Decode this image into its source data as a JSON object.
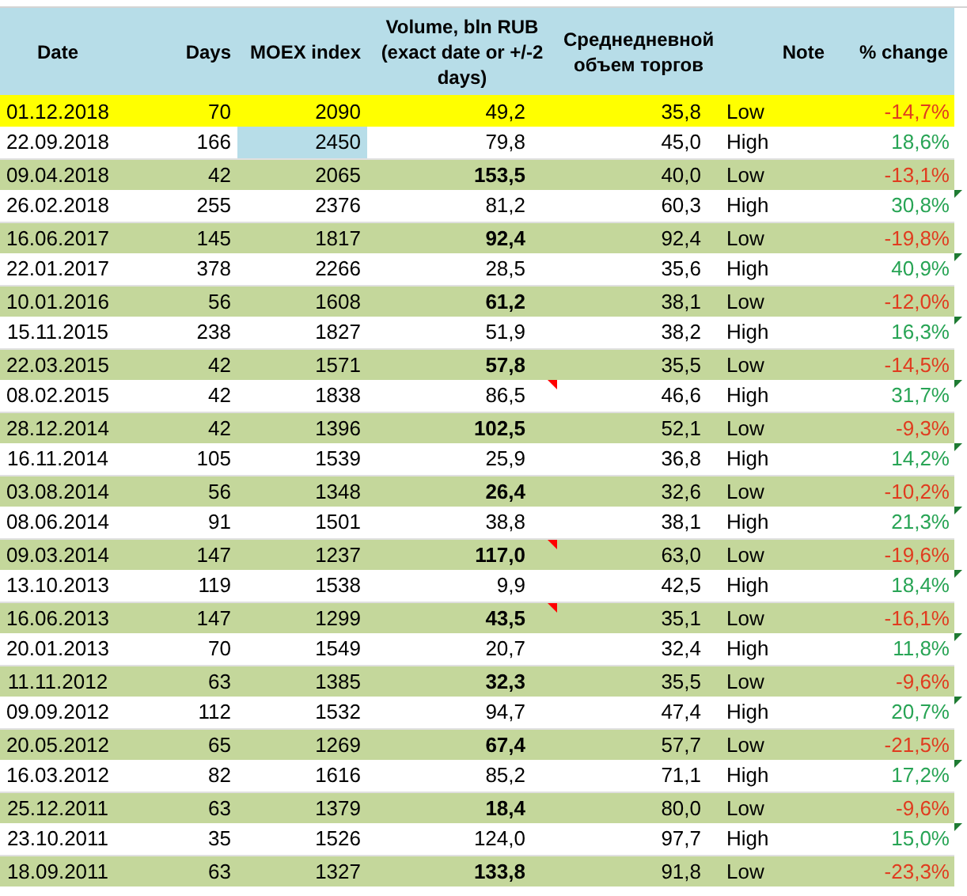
{
  "columns": [
    "Date",
    "Days",
    "MOEX index",
    "Volume, bln RUB (exact date or +/-2 days)",
    "Среднедневной объем торгов",
    "Note",
    "% change"
  ],
  "rows": [
    {
      "kind": "current",
      "date": "01.12.2018",
      "days": "70",
      "index": "2090",
      "volume": "49,2",
      "average": "35,8",
      "note": "Low",
      "change": "-14,7%",
      "color": "#e03c1f"
    },
    {
      "kind": "high",
      "date": "22.09.2018",
      "days": "166",
      "index": "2450",
      "index_highlighted": true,
      "volume": "79,8",
      "average": "45,0",
      "note": "High",
      "change": "18,6%",
      "color": "#28a455"
    },
    {
      "kind": "low",
      "date": "09.04.2018",
      "days": "42",
      "index": "2065",
      "volume": "153,5",
      "average": "40,0",
      "note": "Low",
      "change": "-13,1%",
      "color": "#e03c1f"
    },
    {
      "kind": "high",
      "date": "26.02.2018",
      "days": "255",
      "index": "2376",
      "volume": "81,2",
      "average": "60,3",
      "note": "High",
      "change": "30,8%",
      "color": "#28a455",
      "warning": true
    },
    {
      "kind": "low",
      "date": "16.06.2017",
      "days": "145",
      "index": "1817",
      "volume": "92,4",
      "average": "92,4",
      "note": "Low",
      "change": "-19,8%",
      "color": "#e03c1f"
    },
    {
      "kind": "high",
      "date": "22.01.2017",
      "days": "378",
      "index": "2266",
      "volume": "28,5",
      "average": "35,6",
      "note": "High",
      "change": "40,9%",
      "color": "#28a455",
      "warning": true
    },
    {
      "kind": "low",
      "date": "10.01.2016",
      "days": "56",
      "index": "1608",
      "volume": "61,2",
      "average": "38,1",
      "note": "Low",
      "change": "-12,0%",
      "color": "#e03c1f"
    },
    {
      "kind": "high",
      "date": "15.11.2015",
      "days": "238",
      "index": "1827",
      "volume": "51,9",
      "average": "38,2",
      "note": "High",
      "change": "16,3%",
      "color": "#28a455",
      "warning": true
    },
    {
      "kind": "low",
      "date": "22.03.2015",
      "days": "42",
      "index": "1571",
      "volume": "57,8",
      "average": "35,5",
      "note": "Low",
      "change": "-14,5%",
      "color": "#e03c1f"
    },
    {
      "kind": "high",
      "date": "08.02.2015",
      "days": "42",
      "index": "1838",
      "volume": "86,5",
      "comment": true,
      "average": "46,6",
      "note": "High",
      "change": "31,7%",
      "color": "#28a455",
      "warning": true
    },
    {
      "kind": "low",
      "date": "28.12.2014",
      "days": "42",
      "index": "1396",
      "volume": "102,5",
      "average": "52,1",
      "note": "Low",
      "change": "-9,3%",
      "color": "#e03c1f"
    },
    {
      "kind": "high",
      "date": "16.11.2014",
      "days": "105",
      "index": "1539",
      "volume": "25,9",
      "average": "36,8",
      "note": "High",
      "change": "14,2%",
      "color": "#28a455",
      "warning": true
    },
    {
      "kind": "low",
      "date": "03.08.2014",
      "days": "56",
      "index": "1348",
      "volume": "26,4",
      "average": "32,6",
      "note": "Low",
      "change": "-10,2%",
      "color": "#e03c1f"
    },
    {
      "kind": "high",
      "date": "08.06.2014",
      "days": "91",
      "index": "1501",
      "volume": "38,8",
      "average": "38,1",
      "note": "High",
      "change": "21,3%",
      "color": "#28a455",
      "warning": true
    },
    {
      "kind": "low",
      "date": "09.03.2014",
      "days": "147",
      "index": "1237",
      "volume": "117,0",
      "comment": true,
      "average": "63,0",
      "note": "Low",
      "change": "-19,6%",
      "color": "#e03c1f"
    },
    {
      "kind": "high",
      "date": "13.10.2013",
      "days": "119",
      "index": "1538",
      "volume": "9,9",
      "average": "42,5",
      "note": "High",
      "change": "18,4%",
      "color": "#28a455",
      "warning": true
    },
    {
      "kind": "low",
      "date": "16.06.2013",
      "days": "147",
      "index": "1299",
      "volume": "43,5",
      "comment": true,
      "average": "35,1",
      "note": "Low",
      "change": "-16,1%",
      "color": "#e03c1f"
    },
    {
      "kind": "high",
      "date": "20.01.2013",
      "days": "70",
      "index": "1549",
      "volume": "20,7",
      "average": "32,4",
      "note": "High",
      "change": "11,8%",
      "color": "#28a455",
      "warning": true
    },
    {
      "kind": "low",
      "date": "11.11.2012",
      "days": "63",
      "index": "1385",
      "volume": "32,3",
      "average": "35,5",
      "note": "Low",
      "change": "-9,6%",
      "color": "#e03c1f"
    },
    {
      "kind": "high",
      "date": "09.09.2012",
      "days": "112",
      "index": "1532",
      "volume": "94,7",
      "average": "47,4",
      "note": "High",
      "change": "20,7%",
      "color": "#28a455",
      "warning": true
    },
    {
      "kind": "low",
      "date": "20.05.2012",
      "days": "65",
      "index": "1269",
      "volume": "67,4",
      "average": "57,7",
      "note": "Low",
      "change": "-21,5%",
      "color": "#e03c1f"
    },
    {
      "kind": "high",
      "date": "16.03.2012",
      "days": "82",
      "index": "1616",
      "volume": "85,2",
      "average": "71,1",
      "note": "High",
      "change": "17,2%",
      "color": "#28a455",
      "warning": true
    },
    {
      "kind": "low",
      "date": "25.12.2011",
      "days": "63",
      "index": "1379",
      "volume": "18,4",
      "average": "80,0",
      "note": "Low",
      "change": "-9,6%",
      "color": "#e03c1f"
    },
    {
      "kind": "high",
      "date": "23.10.2011",
      "days": "35",
      "index": "1526",
      "volume": "124,0",
      "average": "97,7",
      "note": "High",
      "change": "15,0%",
      "color": "#28a455",
      "warning": true
    },
    {
      "kind": "low",
      "date": "18.09.2011",
      "days": "63",
      "index": "1327",
      "volume": "133,8",
      "average": "91,8",
      "note": "Low",
      "change": "-23,3%",
      "color": "#e03c1f"
    }
  ]
}
